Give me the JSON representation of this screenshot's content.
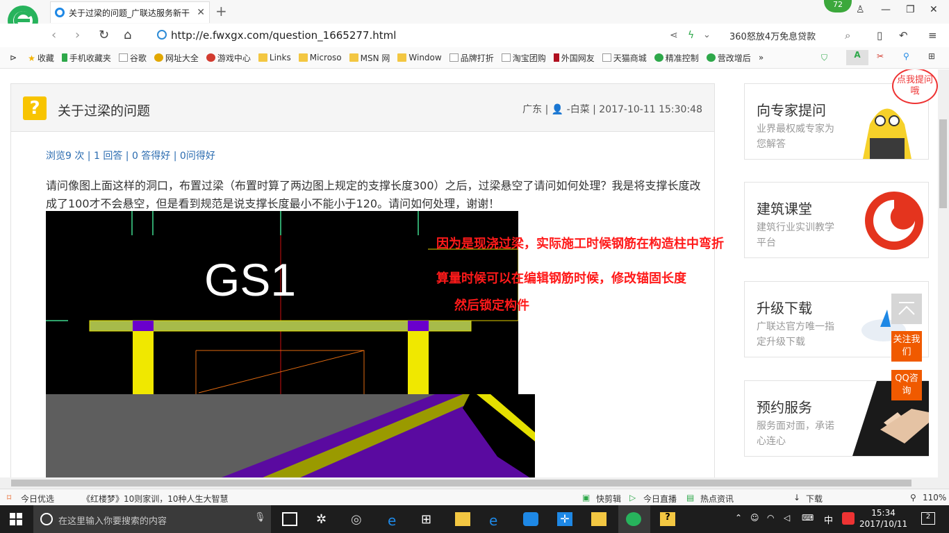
{
  "browser": {
    "tab_title": "关于过梁的问题_广联达服务新干",
    "url": "http://e.fwxgx.com/question_1665277.html",
    "badge_count": "72",
    "ad_text": "360怒放4万免息贷款"
  },
  "bookmarks": [
    {
      "label": "收藏",
      "icon": "star"
    },
    {
      "label": "手机收藏夹",
      "icon": "phone"
    },
    {
      "label": "谷歌",
      "icon": "page"
    },
    {
      "label": "网址大全",
      "icon": "globe"
    },
    {
      "label": "游戏中心",
      "icon": "game"
    },
    {
      "label": "Links",
      "icon": "folder"
    },
    {
      "label": "Microso",
      "icon": "folder"
    },
    {
      "label": "MSN 网",
      "icon": "folder"
    },
    {
      "label": "Window",
      "icon": "folder"
    },
    {
      "label": "品牌打折",
      "icon": "page"
    },
    {
      "label": "淘宝团购",
      "icon": "page"
    },
    {
      "label": "外国网友",
      "icon": "flag"
    },
    {
      "label": "天猫商城",
      "icon": "page"
    },
    {
      "label": "精准控制",
      "icon": "wechat"
    },
    {
      "label": "营改增后",
      "icon": "wechat"
    }
  ],
  "question": {
    "title": "关于过梁的问题",
    "meta": "广东 | 👤 -白菜 | 2017-10-11 15:30:48",
    "stats": "浏览9 次 | 1 回答 | 0 答得好 | 0问得好",
    "body": "请问像图上面这样的洞口，布置过梁（布置时算了两边图上规定的支撑长度300）之后，过梁悬空了请问如何处理？我是将支撑长度改成了100才不会悬空，但是看到规范是说支撑长度最小不能小于120。请问如何处理，谢谢！",
    "cad_label": "GS1",
    "annotations": [
      "因为是现浇过梁，实际施工时候钢筋在构造柱中弯折",
      "算量时候可以在编辑钢筋时候，修改锚固长度",
      "然后锁定构件"
    ]
  },
  "sidebar": {
    "cards": [
      {
        "title": "向专家提问",
        "sub": "业界最权威专家为您解答",
        "icon": "mascot-icon"
      },
      {
        "title": "建筑课堂",
        "sub": "建筑行业实训教学平台",
        "icon": "logo-icon"
      },
      {
        "title": "升级下载",
        "sub": "广联达官方唯一指定升级下载",
        "icon": "cloud-download-icon"
      },
      {
        "title": "预约服务",
        "sub": "服务面对面，承诺心连心",
        "icon": "handshake-icon"
      }
    ],
    "bubble": "点我提问哦",
    "follow_btn": "关注我们",
    "qq_btn": "QQ咨询"
  },
  "statusbar": {
    "left_label": "今日优选",
    "news": "《红楼梦》10则家训，10种人生大智慧",
    "items": [
      "快剪辑",
      "今日直播",
      "热点资讯",
      "下载"
    ],
    "zoom": "110%"
  },
  "taskbar": {
    "search_placeholder": "在这里输入你要搜索的内容",
    "ime": "中",
    "time": "15:34",
    "date": "2017/10/11",
    "notifications": "2"
  },
  "colors": {
    "accent": "#2b6cb0",
    "annotation": "#ff1a1a",
    "orange": "#f05a00"
  }
}
